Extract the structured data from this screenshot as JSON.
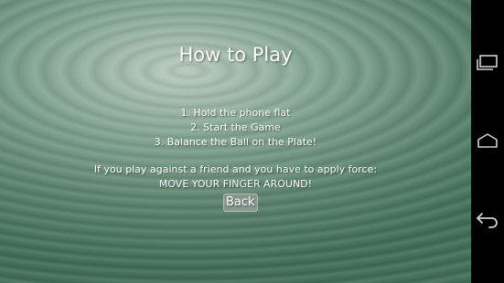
{
  "screen": {
    "title": "How to Play",
    "steps": [
      "1. Hold the phone flat",
      "2. Start the Game",
      "3. Balance the Ball on the Plate!"
    ],
    "note_line1": "If you play against a friend and you have to apply force:",
    "note_line2": "MOVE YOUR FINGER AROUND!",
    "back_label": "Back"
  },
  "nav_bar": {
    "buttons": [
      "recent-apps-icon",
      "home-icon",
      "back-arrow-icon"
    ]
  },
  "colors": {
    "background_center": "#b7c9bd",
    "background_edge": "#3f6b55",
    "text": "#ffffff",
    "nav_bar": "#000000"
  }
}
